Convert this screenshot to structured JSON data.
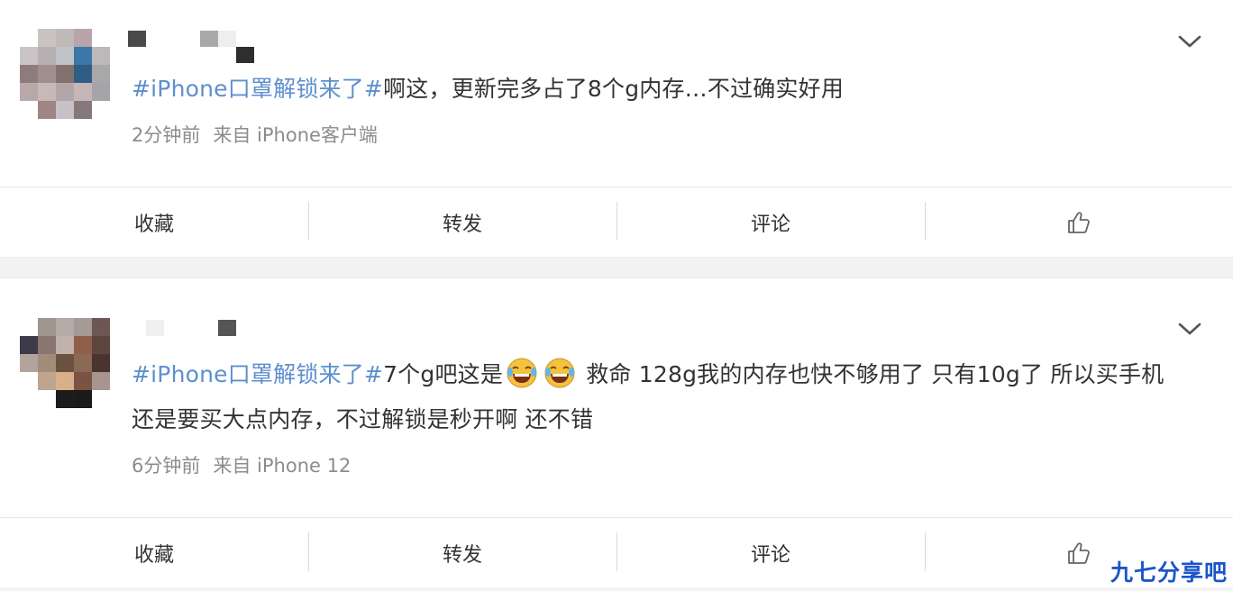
{
  "posts": [
    {
      "topic": "#iPhone口罩解锁来了#",
      "text": "啊这，更新完多占了8个g内存…不过确实好用",
      "time": "2分钟前",
      "source": "来自 iPhone客户端",
      "actions": {
        "favorite": "收藏",
        "repost": "转发",
        "comment": "评论"
      }
    },
    {
      "topic": "#iPhone口罩解锁来了#",
      "text_before_emoji": "7个g吧这是",
      "text_after_emoji": "救命 128g我的内存也快不够用了 只有10g了 所以买手机还是要买大点内存，不过解锁是秒开啊 还不错",
      "emojis": [
        "laugh-cry-emoji",
        "laugh-cry-emoji"
      ],
      "time": "6分钟前",
      "source": "来自 iPhone 12",
      "actions": {
        "favorite": "收藏",
        "repost": "转发",
        "comment": "评论"
      }
    }
  ],
  "icons": {
    "expand": "chevron-down-icon",
    "like": "thumbs-up-icon"
  },
  "colors": {
    "topic": "#5d8fce",
    "meta": "#8c8c8c",
    "watermark": "#1a56c9"
  },
  "watermark": "九七分享吧"
}
